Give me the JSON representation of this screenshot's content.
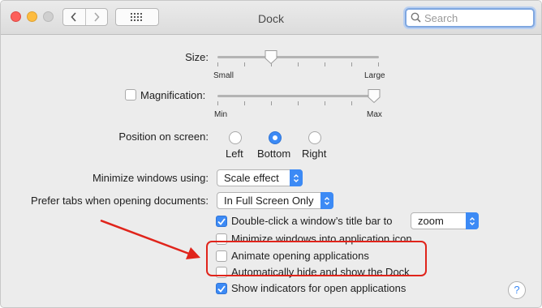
{
  "window": {
    "title": "Dock"
  },
  "search": {
    "placeholder": "Search"
  },
  "size": {
    "label": "Size:",
    "min_label": "Small",
    "max_label": "Large",
    "value_fraction": 0.33
  },
  "magnification": {
    "label": "Magnification:",
    "checked": false,
    "min_label": "Min",
    "max_label": "Max",
    "value_fraction": 1.0
  },
  "position": {
    "label": "Position on screen:",
    "options": [
      "Left",
      "Bottom",
      "Right"
    ],
    "selected": "Bottom"
  },
  "minimize": {
    "label": "Minimize windows using:",
    "value": "Scale effect"
  },
  "tabs": {
    "label": "Prefer tabs when opening documents:",
    "value": "In Full Screen Only"
  },
  "double_click": {
    "label": "Double-click a window’s title bar to",
    "checked": true,
    "value": "zoom"
  },
  "minimize_into_icon": {
    "label": "Minimize windows into application icon",
    "checked": false
  },
  "animate": {
    "label": "Animate opening applications",
    "checked": false
  },
  "autohide": {
    "label": "Automatically hide and show the Dock",
    "checked": false
  },
  "indicators": {
    "label": "Show indicators for open applications",
    "checked": true
  },
  "help": {
    "label": "?"
  },
  "icons": [
    "back-chevron-icon",
    "forward-chevron-icon",
    "grid-icon",
    "search-icon",
    "checkmark-icon",
    "stepper-icon",
    "help-icon"
  ],
  "colors": {
    "accent": "#3c8af5",
    "annotation": "#e0241b"
  }
}
